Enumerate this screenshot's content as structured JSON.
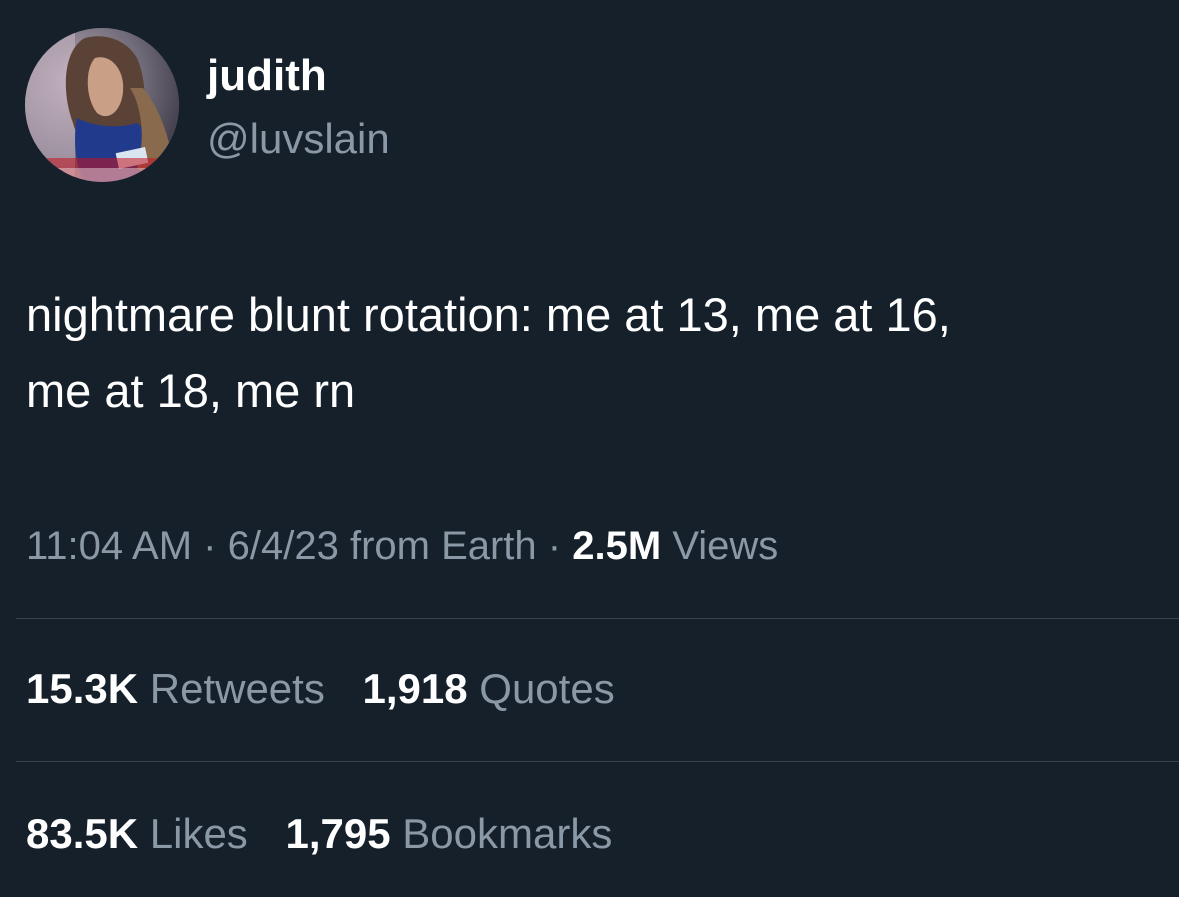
{
  "colors": {
    "background": "#15202b",
    "primary_text": "#ffffff",
    "secondary_text": "#8b98a5",
    "divider": "#38444d"
  },
  "author": {
    "display_name": "judith",
    "handle": "@luvslain",
    "avatar_icon": "user-avatar-photo"
  },
  "tweet": {
    "text_lines": [
      "nightmare blunt rotation: me at 13, me at 16,",
      "me at 18, me rn"
    ]
  },
  "meta": {
    "time": "11:04 AM",
    "separator": "·",
    "date_source": "6/4/23 from Earth",
    "views_count": "2.5M",
    "views_label": "Views"
  },
  "stats": {
    "retweets_count": "15.3K",
    "retweets_label": "Retweets",
    "quotes_count": "1,918",
    "quotes_label": "Quotes",
    "likes_count": "83.5K",
    "likes_label": "Likes",
    "bookmarks_count": "1,795",
    "bookmarks_label": "Bookmarks"
  }
}
